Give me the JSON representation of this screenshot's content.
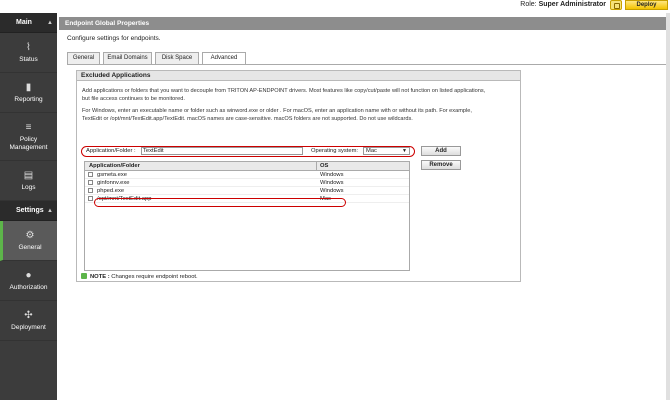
{
  "topbar": {
    "role_label": "Role:",
    "role_value": "Super Administrator",
    "deploy_label": "Deploy"
  },
  "sidebar": {
    "main_header": "Main",
    "main_items": [
      {
        "label": "Status",
        "icon": "pulse-icon"
      },
      {
        "label": "Reporting",
        "icon": "bar-chart-icon"
      },
      {
        "label": "Policy Management",
        "icon": "list-icon"
      },
      {
        "label": "Logs",
        "icon": "log-icon"
      }
    ],
    "settings_header": "Settings",
    "settings_items": [
      {
        "label": "General",
        "icon": "gear-icon",
        "active": true
      },
      {
        "label": "Authorization",
        "icon": "user-icon"
      },
      {
        "label": "Deployment",
        "icon": "network-icon"
      }
    ]
  },
  "page": {
    "title": "Endpoint Global Properties",
    "subtitle": "Configure settings for endpoints."
  },
  "tabs": [
    {
      "label": "General"
    },
    {
      "label": "Email Domains"
    },
    {
      "label": "Disk Space"
    },
    {
      "label": "Advanced",
      "active": true
    }
  ],
  "panel": {
    "title": "Excluded Applications",
    "para1_line1": "Add applications or folders that you want to decouple from TRITON AP-ENDPOINT drivers. Most features like copy/cut/paste will not function on listed applications,",
    "para1_line2": "but file access continues to be monitored.",
    "para2_line1": "For Windows, enter an executable name or folder such as winword.exe or older . For macOS, enter an application name with or without its path. For example,",
    "para2_line2": "TextEdit or /opt/mnt/TextEdit.app/TextEdit. macOS names are case-sensitive. macOS folders are not supported. Do not use wildcards.",
    "app_label": "Application/Folder :",
    "app_value": "TextEdit",
    "os_label": "Operating system:",
    "os_value": "Mac",
    "add_label": "Add",
    "remove_label": "Remove",
    "col_app": "Application/Folder",
    "col_os": "OS",
    "rows": [
      {
        "app": "gsmeta.exe",
        "os": "Windows"
      },
      {
        "app": "ginfonnv.exe",
        "os": "Windows"
      },
      {
        "app": "phped.exe",
        "os": "Windows"
      },
      {
        "app": "/opt/mnt/TextEdit.app",
        "os": "Mac"
      }
    ],
    "note_bold": "NOTE :",
    "note_text": "Changes require endpoint reboot."
  },
  "colors": {
    "accent_green": "#5db54a",
    "title_bar": "#8d8d8d",
    "sidebar_bg": "#3c3c3c",
    "deploy_yellow": "#f3c400",
    "highlight_red": "#cc0000"
  }
}
